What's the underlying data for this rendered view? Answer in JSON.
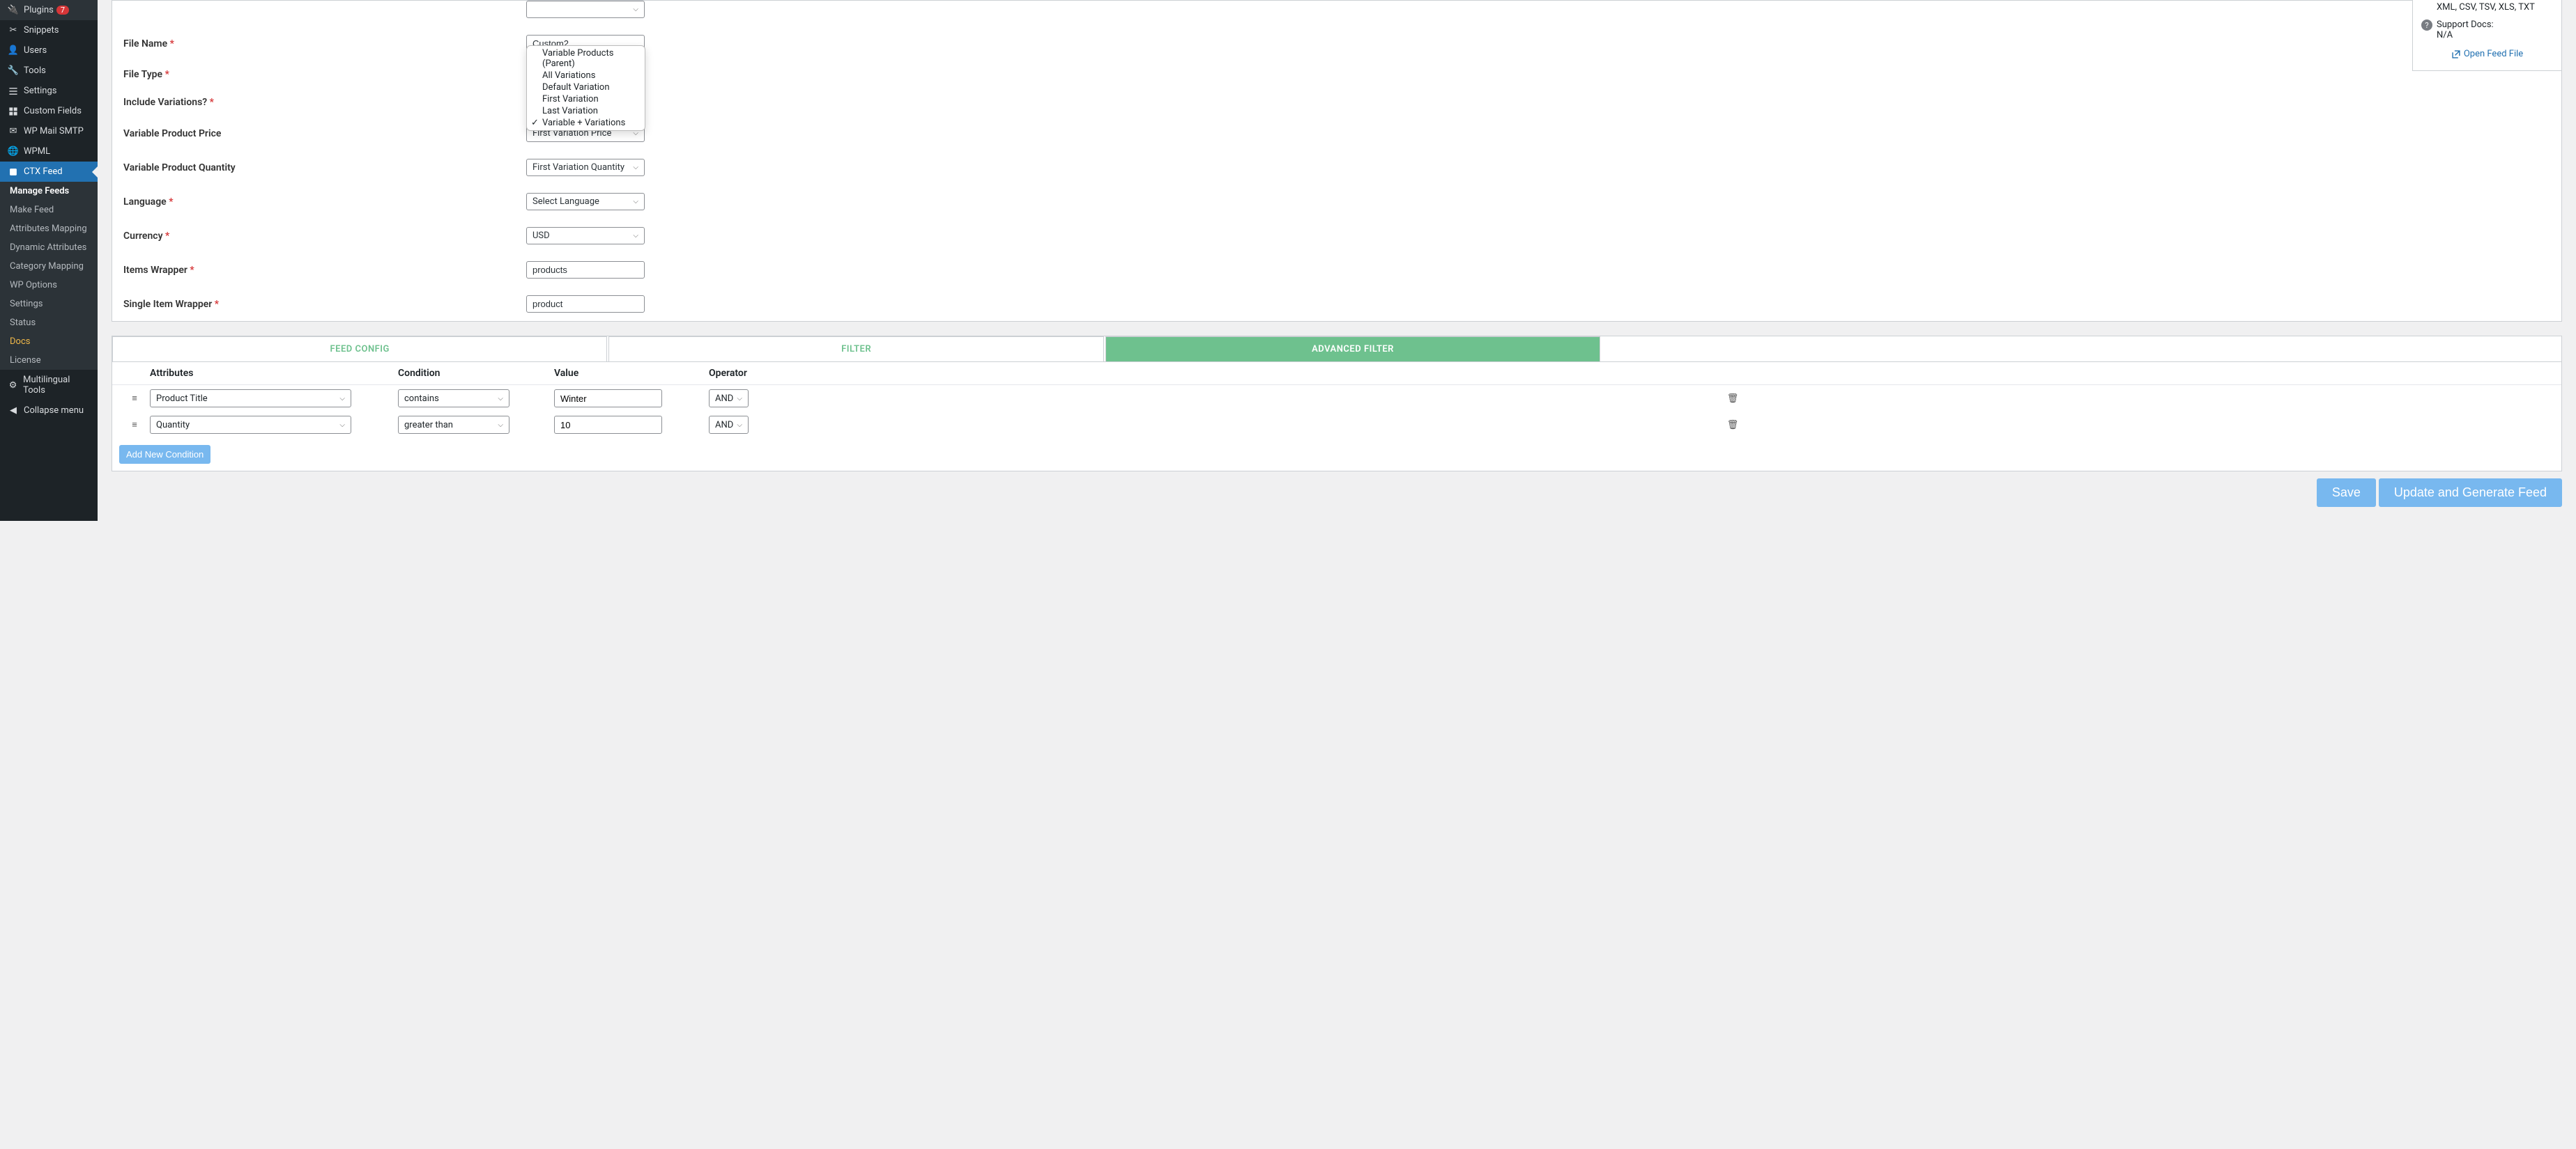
{
  "sidebar": {
    "plugins": "Plugins",
    "plugins_badge": "7",
    "snippets": "Snippets",
    "users": "Users",
    "tools": "Tools",
    "settings": "Settings",
    "custom_fields": "Custom Fields",
    "wp_mail_smtp": "WP Mail SMTP",
    "wpml": "WPML",
    "ctx_feed": "CTX Feed",
    "multilingual_tools": "Multilingual Tools",
    "collapse": "Collapse menu"
  },
  "submenu": {
    "manage_feeds": "Manage Feeds",
    "make_feed": "Make Feed",
    "attr_mapping": "Attributes Mapping",
    "dyn_attr": "Dynamic Attributes",
    "cat_mapping": "Category Mapping",
    "wp_options": "WP Options",
    "settings": "Settings",
    "status": "Status",
    "docs": "Docs",
    "license": "License"
  },
  "form": {
    "file_name_label": "File Name",
    "file_name_value": "Custom2",
    "file_type_label": "File Type",
    "include_var_label": "Include Variations?",
    "var_price_label": "Variable Product Price",
    "var_price_value": "First Variation Price",
    "var_qty_label": "Variable Product Quantity",
    "var_qty_value": "First Variation Quantity",
    "language_label": "Language",
    "language_value": "Select Language",
    "currency_label": "Currency",
    "currency_value": "USD",
    "items_wrapper_label": "Items Wrapper",
    "items_wrapper_value": "products",
    "single_wrapper_label": "Single Item Wrapper",
    "single_wrapper_value": "product"
  },
  "dropdown_options": {
    "o1": "Variable Products (Parent)",
    "o2": "All Variations",
    "o3": "Default Variation",
    "o4": "First Variation",
    "o5": "Last Variation",
    "o6": "Variable + Variations"
  },
  "right_panel": {
    "formats": "XML, CSV, TSV, XLS, TXT",
    "support_docs": "Support Docs:",
    "na": "N/A",
    "open_feed": "Open Feed File"
  },
  "tabs": {
    "feed_config": "FEED CONFIG",
    "filter": "FILTER",
    "adv_filter": "ADVANCED FILTER"
  },
  "filter_headers": {
    "attributes": "Attributes",
    "condition": "Condition",
    "value": "Value",
    "operator": "Operator"
  },
  "filter_rows": {
    "r1_attr": "Product Title",
    "r1_cond": "contains",
    "r1_val": "Winter",
    "r1_op": "AND",
    "r2_attr": "Quantity",
    "r2_cond": "greater than",
    "r2_val": "10",
    "r2_op": "AND"
  },
  "buttons": {
    "add_condition": "Add New Condition",
    "save": "Save",
    "generate": "Update and Generate Feed"
  }
}
